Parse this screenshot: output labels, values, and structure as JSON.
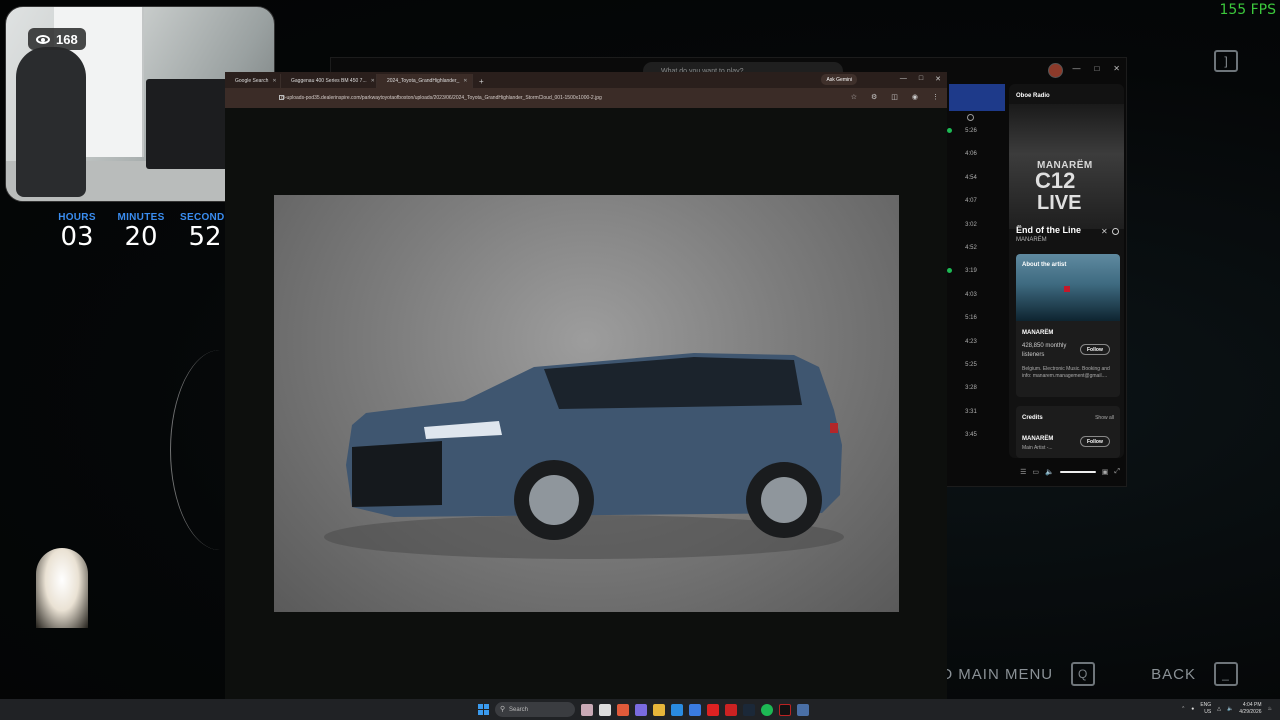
{
  "overlay": {
    "fps": "155 FPS",
    "viewers": "168",
    "timer": {
      "hours_label": "HOURS",
      "hours": "03",
      "minutes_label": "MINUTES",
      "minutes": "20",
      "seconds_label": "SECONDS",
      "seconds": "52"
    },
    "quit_label": "QUIT TO MAIN MENU",
    "quit_key": "Q",
    "back_label": "BACK",
    "back_key": "_",
    "top_key": "]"
  },
  "spotify": {
    "search_placeholder": "What do you want to play?",
    "durations": [
      "5:26",
      "4:06",
      "4:54",
      "4:07",
      "3:02",
      "4:52",
      "3:19",
      "4:03",
      "5:16",
      "4:23",
      "5:25",
      "3:28",
      "3:31",
      "3:45"
    ],
    "now_playing": {
      "radio": "Oboe Radio",
      "art_line1": "MANARËM",
      "art_line2": "C12",
      "art_line3": "LIVE",
      "title": "Ënd of the Line",
      "artist": "MANARËM"
    },
    "about": {
      "heading": "About the artist",
      "name": "MANARËM",
      "listeners": "428,850 monthly listeners",
      "follow": "Follow",
      "bio": "Belgium. Electronic Music. Booking and info: manarem.management@gmail...."
    },
    "credits": {
      "heading": "Credits",
      "show_all": "Show all",
      "name": "MANARËM",
      "role": "Main Artist -...",
      "follow": "Follow"
    }
  },
  "browser": {
    "tabs": [
      {
        "label": "Google Search",
        "fav": "google"
      },
      {
        "label": "Gaggenau 400 Series BM 450 7...",
        "fav": "red"
      },
      {
        "label": "2024_Toyota_GrandHighlander_",
        "fav": "globe",
        "active": true
      }
    ],
    "ask_gemini": "Ask Gemini",
    "url": "di-uploads-pod35.dealerinspire.com/parkwaytoyotaofboston/uploads/2023/06/2024_Toyota_GrandHighlander_StormCloud_001-1500x1000-2.jpg"
  },
  "taskbar": {
    "search": "Search",
    "lang_line1": "ENG",
    "lang_line2": "US",
    "time": "4:04 PM",
    "date": "4/29/2026"
  }
}
